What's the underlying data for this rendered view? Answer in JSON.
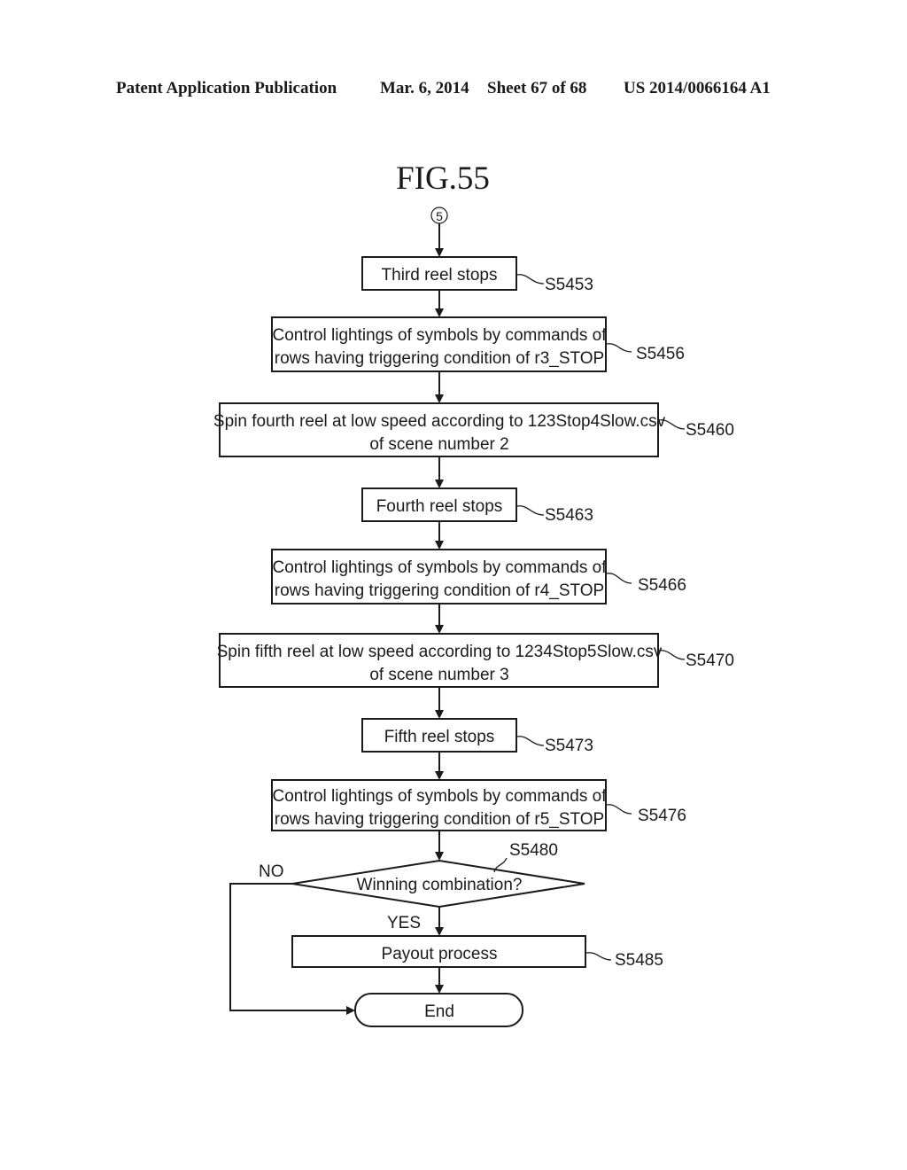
{
  "header": {
    "publication": "Patent Application Publication",
    "date": "Mar. 6, 2014",
    "sheet": "Sheet 67 of 68",
    "number": "US 2014/0066164 A1"
  },
  "figure": {
    "title": "FIG.55",
    "connector": "5"
  },
  "steps": [
    {
      "id": "S5453",
      "lines": [
        "Third reel stops"
      ]
    },
    {
      "id": "S5456",
      "lines": [
        "Control lightings of symbols by commands of",
        "rows having triggering condition of r3_STOP"
      ]
    },
    {
      "id": "S5460",
      "lines": [
        "Spin fourth reel at low speed according to 123Stop4Slow.csv",
        "of scene number 2"
      ]
    },
    {
      "id": "S5463",
      "lines": [
        "Fourth reel stops"
      ]
    },
    {
      "id": "S5466",
      "lines": [
        "Control lightings of symbols by commands of",
        "rows having triggering condition of r4_STOP"
      ]
    },
    {
      "id": "S5470",
      "lines": [
        "Spin fifth reel at low speed according to 1234Stop5Slow.csv",
        "of scene number 3"
      ]
    },
    {
      "id": "S5473",
      "lines": [
        "Fifth reel stops"
      ]
    },
    {
      "id": "S5476",
      "lines": [
        "Control lightings of symbols by commands of",
        "rows having triggering condition of r5_STOP"
      ]
    }
  ],
  "decision": {
    "id": "S5480",
    "question": "Winning combination?",
    "yes_label": "YES",
    "no_label": "NO"
  },
  "payout": {
    "id": "S5485",
    "label": "Payout process"
  },
  "terminal": {
    "label": "End"
  }
}
